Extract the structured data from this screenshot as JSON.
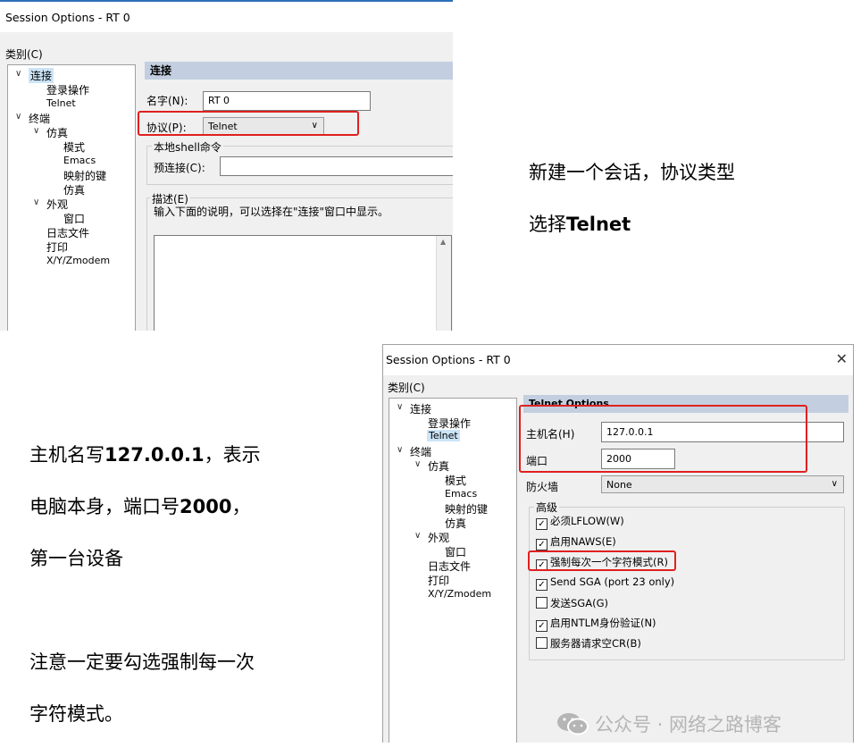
{
  "dialog1": {
    "title": "Session Options - RT 0",
    "category_label": "类别(C)",
    "tree": [
      "连接",
      "登录操作",
      "Telnet",
      "终端",
      "仿真",
      "模式",
      "Emacs",
      "映射的键",
      "仿真",
      "外观",
      "窗口",
      "日志文件",
      "打印",
      "X/Y/Zmodem"
    ],
    "section_header": "连接",
    "name_label": "名字(N):",
    "name_value": "RT 0",
    "protocol_label": "协议(P):",
    "protocol_value": "Telnet",
    "shell_group": "本地shell命令",
    "preconnect_label": "预连接(C):",
    "desc_label": "描述(E)",
    "desc_hint": "输入下面的说明，可以选择在\"连接\"窗口中显示。"
  },
  "note1": {
    "line1": "新建一个会话，协议类型",
    "line2_prefix": "选择",
    "line2_bold": "Telnet"
  },
  "note2": {
    "l1_prefix": "主机名写",
    "l1_bold": "127.0.0.1",
    "l1_suffix": "，表示",
    "l2_prefix": "电脑本身，端口号",
    "l2_bold": "2000",
    "l2_suffix": "，",
    "l3": "第一台设备",
    "l4": "注意一定要勾选强制每一次",
    "l5": "字符模式。"
  },
  "dialog2": {
    "title": "Session Options - RT 0",
    "category_label": "类别(C)",
    "tree": [
      "连接",
      "登录操作",
      "Telnet",
      "终端",
      "仿真",
      "模式",
      "Emacs",
      "映射的键",
      "仿真",
      "外观",
      "窗口",
      "日志文件",
      "打印",
      "X/Y/Zmodem"
    ],
    "section_header": "Telnet Options",
    "host_label": "主机名(H)",
    "host_value": "127.0.0.1",
    "port_label": "端口",
    "port_value": "2000",
    "firewall_label": "防火墙",
    "firewall_value": "None",
    "advanced_group": "高级",
    "options": [
      {
        "label": "必须LFLOW(W)",
        "checked": true
      },
      {
        "label": "启用NAWS(E)",
        "checked": true
      },
      {
        "label": "强制每次一个字符模式(R)",
        "checked": true
      },
      {
        "label": "Send SGA (port 23 only)",
        "checked": true
      },
      {
        "label": "发送SGA(G)",
        "checked": false
      },
      {
        "label": "启用NTLM身份验证(N)",
        "checked": true
      },
      {
        "label": "服务器请求空CR(B)",
        "checked": false
      }
    ]
  },
  "watermark": "公众号 · 网络之路博客"
}
